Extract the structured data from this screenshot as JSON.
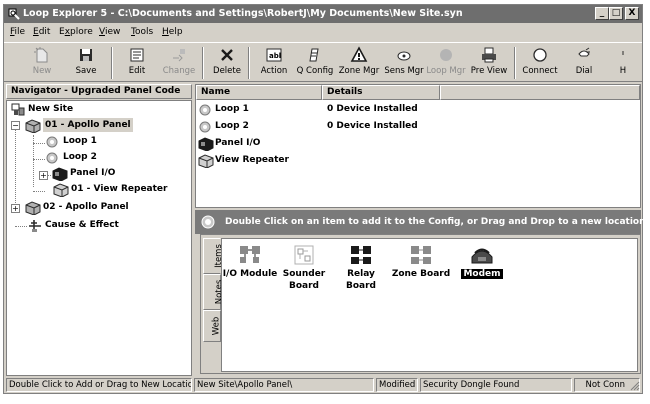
{
  "window": {
    "title": "Loop Explorer 5 - C:\\Documents and Settings\\RobertJ\\My Documents\\New Site.syn",
    "controls": [
      "_",
      "□",
      "X"
    ]
  },
  "menu": [
    {
      "label": "File",
      "key": "F",
      "rest": "ile"
    },
    {
      "label": "Edit",
      "key": "E",
      "rest": "dit"
    },
    {
      "label": "Explore",
      "key": "x",
      "pre": "E",
      "rest": "plore"
    },
    {
      "label": "View",
      "key": "V",
      "rest": "iew"
    },
    {
      "label": "Tools",
      "key": "T",
      "rest": "ools"
    },
    {
      "label": "Help",
      "key": "H",
      "rest": "elp"
    }
  ],
  "toolbar": {
    "new": "New",
    "save": "Save",
    "edit": "Edit",
    "change": "Change",
    "delete": "Delete",
    "action": "Action",
    "qconfig": "Q Config",
    "zonemgr": "Zone Mgr",
    "sensmgr": "Sens Mgr",
    "loopmgr": "Loop Mgr",
    "preview": "Pre View",
    "connect": "Connect",
    "dial": "Dial",
    "more": "H"
  },
  "navigator": {
    "header": "Navigator - Upgraded Panel Code",
    "items": [
      {
        "label": "New Site",
        "icon": "site-icon"
      },
      {
        "label": "01 - Apollo Panel",
        "icon": "panel-icon",
        "selected": true
      },
      {
        "label": "Loop 1",
        "icon": "loop-icon"
      },
      {
        "label": "Loop 2",
        "icon": "loop-icon"
      },
      {
        "label": "Panel I/O",
        "icon": "panel-io-icon"
      },
      {
        "label": "01 - View Repeater",
        "icon": "repeater-icon"
      },
      {
        "label": "02 - Apollo Panel",
        "icon": "panel-icon"
      },
      {
        "label": "Cause & Effect",
        "icon": "cause-effect-icon"
      }
    ]
  },
  "list": {
    "columns": [
      "Name",
      "Details"
    ],
    "rows": [
      {
        "name": "Loop 1",
        "details": "0 Device Installed"
      },
      {
        "name": "Loop 2",
        "details": "0 Device Installed"
      },
      {
        "name": "Panel I/O",
        "details": ""
      },
      {
        "name": "View Repeater",
        "details": ""
      }
    ]
  },
  "hint": "Double Click on an item to add it to the Config, or Drag and Drop to a new location",
  "palette": {
    "tabs": [
      "Items",
      "Notes",
      "Web"
    ],
    "items": [
      {
        "label": "I/O Module",
        "label2": ""
      },
      {
        "label": "Sounder",
        "label2": "Board"
      },
      {
        "label": "Relay",
        "label2": "Board"
      },
      {
        "label": "Zone Board",
        "label2": ""
      },
      {
        "label": "Modem",
        "label2": "",
        "selected": true
      }
    ]
  },
  "status": {
    "hint": "Double Click to Add or Drag to New Location",
    "path": "New Site\\Apollo Panel\\",
    "modified": "Modified",
    "dongle": "Security Dongle Found",
    "connection": "Not Conn"
  }
}
